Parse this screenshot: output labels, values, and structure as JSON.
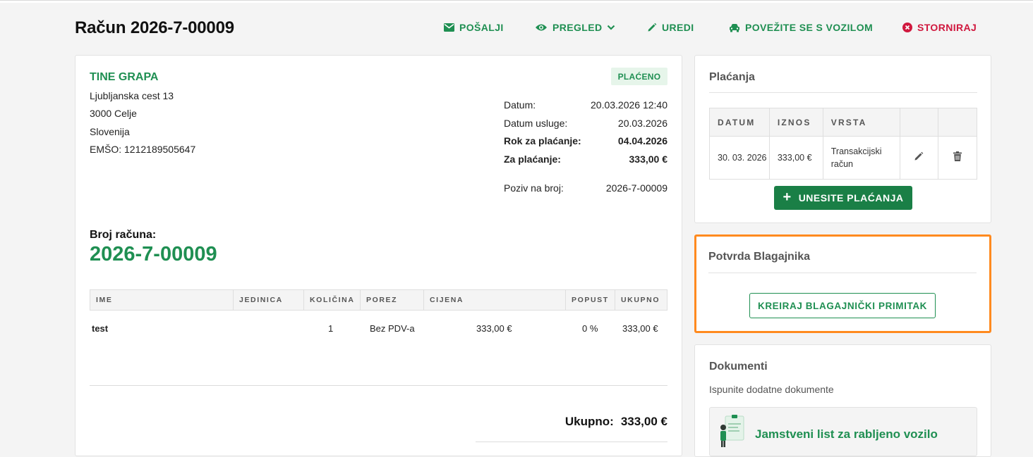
{
  "header": {
    "title": "Račun 2026-7-00009",
    "actions": {
      "send": "POŠALJI",
      "preview": "PREGLED",
      "edit": "UREDI",
      "vehicle": "POVEŽITE SE S VOZILOM",
      "cancel": "STORNIRAJ"
    }
  },
  "invoice": {
    "client": {
      "name": "TINE GRAPA",
      "street": "Ljubljanska cest 13",
      "city": "3000 Celje",
      "country": "Slovenija",
      "id": "EMŠO: 1212189505647"
    },
    "status_badge": "PLAĆENO",
    "meta": [
      {
        "label": "Datum:",
        "value": "20.03.2026 12:40"
      },
      {
        "label": "Datum usluge:",
        "value": "20.03.2026"
      },
      {
        "label": "Rok za plaćanje:",
        "value": "04.04.2026"
      },
      {
        "label": "Za plaćanje:",
        "value": "333,00 €"
      },
      {
        "label": "Poziv na broj:",
        "value": "2026-7-00009"
      }
    ],
    "number_label": "Broj računa:",
    "number": "2026-7-00009",
    "items_columns": [
      "IME",
      "JEDINICA",
      "KOLIČINA",
      "POREZ",
      "CIJENA",
      "POPUST",
      "UKUPNO"
    ],
    "items": [
      {
        "name": "test",
        "unit": "",
        "qty": "1",
        "tax": "Bez PDV-a",
        "price": "333,00 €",
        "discount": "0 %",
        "total": "333,00 €"
      }
    ],
    "total_label": "Ukupno:",
    "total_value": "333,00 €"
  },
  "payments": {
    "title": "Plaćanja",
    "columns": [
      "DATUM",
      "IZNOS",
      "VRSTA"
    ],
    "rows": [
      {
        "date": "30. 03. 2026",
        "amount": "333,00 €",
        "type": "Transakcijski račun"
      }
    ],
    "add_button": "UNESITE PLAĆANJA"
  },
  "cashier": {
    "title": "Potvrda Blagajnika",
    "button": "KREIRAJ BLAGAJNIČKI PRIMITAK"
  },
  "documents": {
    "title": "Dokumenti",
    "subtitle": "Ispunite dodatne dokumente",
    "items": [
      {
        "label": "Jamstveni list za rabljeno vozilo"
      }
    ]
  },
  "colors": {
    "accent": "#1f8f52",
    "danger": "#d0183e",
    "highlight": "#ff8a1f",
    "button_bg": "#1a7f46"
  }
}
